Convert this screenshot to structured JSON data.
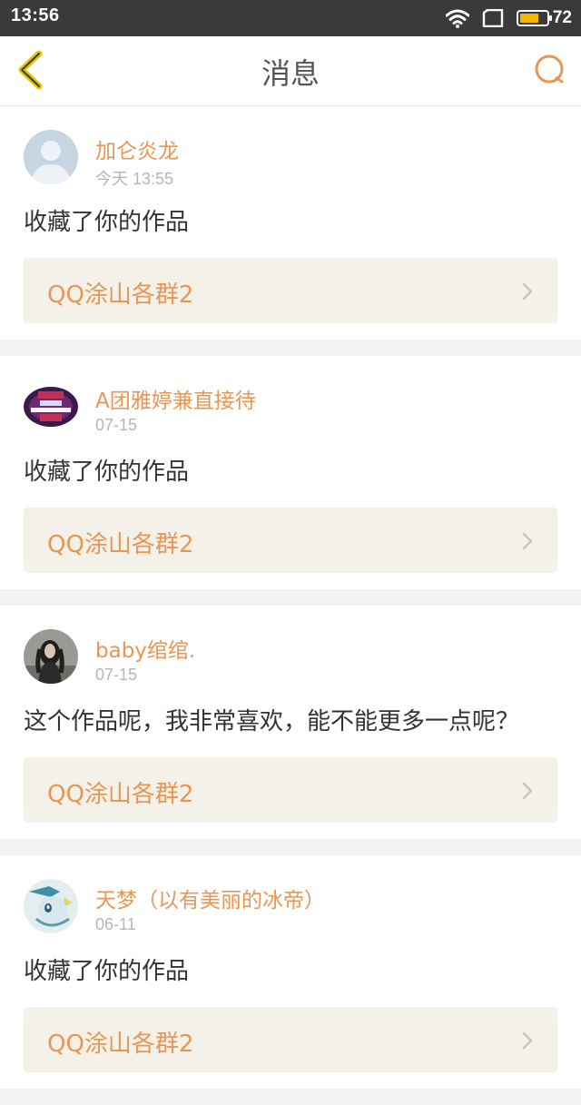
{
  "status_bar": {
    "time": "13:56",
    "battery_percent": "72",
    "battery_level": 0.72,
    "icons": [
      "wifi-icon",
      "screen-icon",
      "battery-icon"
    ]
  },
  "nav": {
    "title": "消息",
    "back_icon": "chevron-left-icon",
    "search_icon": "search-icon"
  },
  "colors": {
    "accent": "#e89656",
    "back_accent": "#e6c300",
    "card_bg": "#f4f2e8"
  },
  "messages": [
    {
      "user": "加仑炎龙",
      "time": "今天 13:55",
      "text": "收藏了你的作品",
      "work_title": "QQ涂山各群2",
      "avatar": "default-avatar"
    },
    {
      "user": "A团雅婷兼直接待",
      "time": "07-15",
      "text": "收藏了你的作品",
      "work_title": "QQ涂山各群2",
      "avatar": "banner-avatar"
    },
    {
      "user": "baby绾绾.",
      "time": "07-15",
      "text": "这个作品呢，我非常喜欢，能不能更多一点呢？",
      "work_title": "QQ涂山各群2",
      "avatar": "photo-avatar"
    },
    {
      "user": "天梦（以有美丽的冰帝）",
      "time": "06-11",
      "text": "收藏了你的作品",
      "work_title": "QQ涂山各群2",
      "avatar": "anime-avatar"
    }
  ]
}
